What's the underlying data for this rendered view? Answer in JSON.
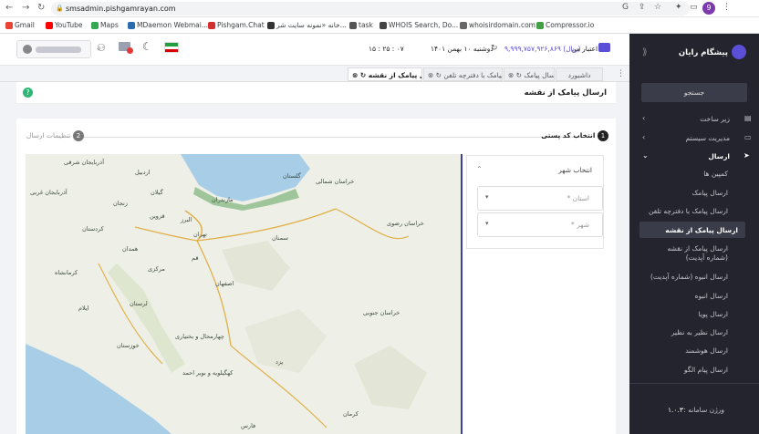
{
  "browser": {
    "url": "smsadmin.pishgamrayan.com",
    "bookmarks": [
      "Gmail",
      "YouTube",
      "Maps",
      "MDaemon Webmai...",
      "Pishgam.Chat",
      "خانه «نمونه سایت شر...",
      "task",
      "WHOIS Search, Do...",
      "whoisirdomain.com",
      "Compressor.io"
    ],
    "profile_initial": "9"
  },
  "header": {
    "time": "۱۵ : ۲۵ : ۰۷",
    "date": "دوشنبه ۱۰ بهمن ۱۴۰۱",
    "credit_label": "اعتبار من :",
    "credit_value": "۹,۹۹۹,۷۵۷,۹۲۶,۸۶۹ (ریال)"
  },
  "tabs": [
    "داشبورد",
    "ارسال پیامک",
    "ارسال پیامک با دفترچه تلفن",
    "ارسال پیامک از نقشه"
  ],
  "page": {
    "title": "ارسال پیامک از نقشه"
  },
  "steps": [
    {
      "num": "1",
      "label": "انتخاب کد پستی"
    },
    {
      "num": "2",
      "label": "تنظیمات ارسال"
    }
  ],
  "city_panel": {
    "title": "انتخاب شهر",
    "province_placeholder": "استان *",
    "city_placeholder": "شهر *"
  },
  "map": {
    "labels": [
      "آذربایجان شرقی",
      "آذربایجان غربی",
      "اردبیل",
      "گیلان",
      "زنجان",
      "قزوین",
      "البرز",
      "تهران",
      "مازندران",
      "گلستان",
      "خراسان شمالی",
      "خراسان رضوی",
      "سمنان",
      "قم",
      "کردستان",
      "همدان",
      "مرکزی",
      "کرمانشاه",
      "لرستان",
      "ایلام",
      "اصفهان",
      "خراسان جنوبی",
      "چهارمحال و بختیاری",
      "خوزستان",
      "کهگیلویه و بویر احمد",
      "یزد",
      "فارس",
      "کرمان"
    ],
    "controls": [
      "→",
      "+",
      "−",
      "⇞"
    ]
  },
  "sidebar": {
    "brand": "پیشگام رایان",
    "search": "جستجو",
    "items": [
      "زیر ساخت",
      "مدیریت سیستم",
      "ارسال",
      "کمپین ها",
      "ارسال پیامک",
      "ارسال پیامک با دفترچه تلفن",
      "ارسال پیامک از نقشه",
      "ارسال پیامک از نقشه (شماره آپدیت)",
      "ارسال انبوه (شماره آپدیت)",
      "ارسال انبوه",
      "ارسال پویا",
      "ارسال نظیر به نظیر",
      "ارسال هوشمند",
      "ارسال پیام الگو"
    ],
    "version_label": "ورژن سامانه :",
    "version": "۱.۰.۳"
  },
  "colors": {
    "sidebar": "#23242d",
    "accent": "#5a4fd6",
    "active": "#3a3c4a",
    "map_water": "#a8cde6",
    "map_green": "#9fc59a"
  }
}
